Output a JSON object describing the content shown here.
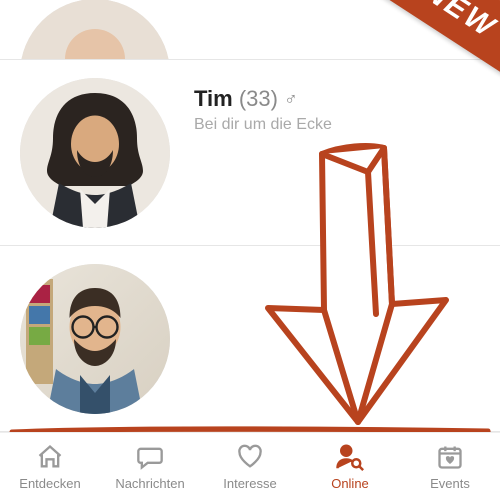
{
  "ribbon": {
    "text": "NEW"
  },
  "list": {
    "items": [
      {
        "name": "",
        "age": "",
        "tagline": ""
      },
      {
        "name": "Tim",
        "age": "(33)",
        "gender": "♂",
        "tagline": "Bei dir um die Ecke"
      },
      {
        "name": "",
        "age": "",
        "tagline": ""
      }
    ]
  },
  "tabs": {
    "items": [
      {
        "label": "Entdecken",
        "active": false
      },
      {
        "label": "Nachrichten",
        "active": false
      },
      {
        "label": "Interesse",
        "active": false
      },
      {
        "label": "Online",
        "active": true
      },
      {
        "label": "Events",
        "active": false
      }
    ]
  },
  "colors": {
    "accent": "#b8431e"
  }
}
